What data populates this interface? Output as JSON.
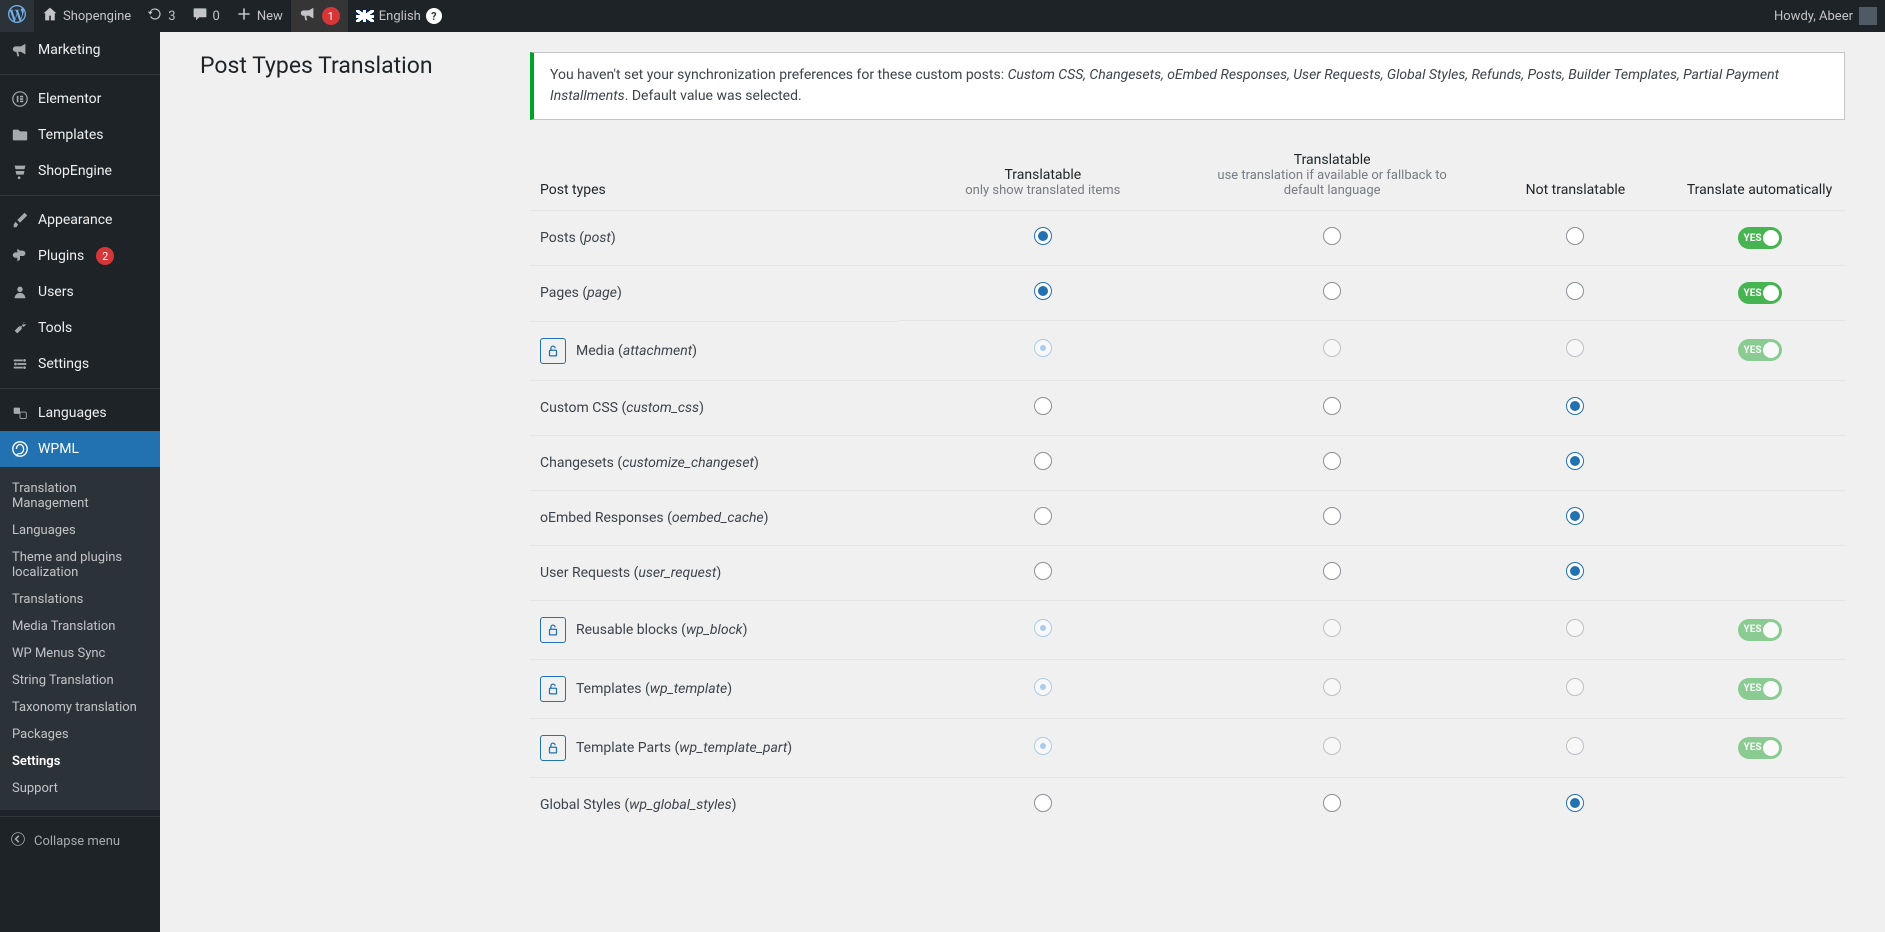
{
  "toolbar": {
    "site_name": "Shopengine",
    "refresh_count": "3",
    "comments_count": "0",
    "new_label": "New",
    "notif_count": "1",
    "language_label": "English",
    "howdy": "Howdy, Abeer"
  },
  "menu": {
    "marketing": "Marketing",
    "elementor": "Elementor",
    "templates": "Templates",
    "shopengine": "ShopEngine",
    "appearance": "Appearance",
    "plugins": "Plugins",
    "plugins_badge": "2",
    "users": "Users",
    "tools": "Tools",
    "settings": "Settings",
    "languages": "Languages",
    "wpml": "WPML",
    "collapse": "Collapse menu"
  },
  "submenu": {
    "translation_management": "Translation Management",
    "languages": "Languages",
    "theme_plugins": "Theme and plugins localization",
    "translations": "Translations",
    "media_translation": "Media Translation",
    "wp_menus_sync": "WP Menus Sync",
    "string_translation": "String Translation",
    "taxonomy_translation": "Taxonomy translation",
    "packages": "Packages",
    "settings": "Settings",
    "support": "Support"
  },
  "page": {
    "title": "Post Types Translation",
    "notice_pre": "You haven't set your synchronization preferences for these custom posts: ",
    "notice_items": "Custom CSS, Changesets, oEmbed Responses, User Requests, Global Styles, Refunds, Posts, Builder Templates, Partial Payment Installments",
    "notice_post": ". Default value was selected."
  },
  "table": {
    "headers": {
      "post_types": "Post types",
      "col1_main": "Translatable",
      "col1_sub": "only show translated items",
      "col2_main": "Translatable",
      "col2_sub": "use translation if available or fallback to default language",
      "col3": "Not translatable",
      "col4": "Translate automatically"
    },
    "toggle_yes": "YES",
    "rows": [
      {
        "label": "Posts",
        "slug": "post",
        "locked": false,
        "selected": 0,
        "toggle": true
      },
      {
        "label": "Pages",
        "slug": "page",
        "locked": false,
        "selected": 0,
        "toggle": true
      },
      {
        "label": "Media",
        "slug": "attachment",
        "locked": true,
        "selected": 0,
        "toggle": true
      },
      {
        "label": "Custom CSS",
        "slug": "custom_css",
        "locked": false,
        "selected": 2,
        "toggle": false
      },
      {
        "label": "Changesets",
        "slug": "customize_changeset",
        "locked": false,
        "selected": 2,
        "toggle": false
      },
      {
        "label": "oEmbed Responses",
        "slug": "oembed_cache",
        "locked": false,
        "selected": 2,
        "toggle": false
      },
      {
        "label": "User Requests",
        "slug": "user_request",
        "locked": false,
        "selected": 2,
        "toggle": false
      },
      {
        "label": "Reusable blocks",
        "slug": "wp_block",
        "locked": true,
        "selected": 0,
        "toggle": true
      },
      {
        "label": "Templates",
        "slug": "wp_template",
        "locked": true,
        "selected": 0,
        "toggle": true
      },
      {
        "label": "Template Parts",
        "slug": "wp_template_part",
        "locked": true,
        "selected": 0,
        "toggle": true
      },
      {
        "label": "Global Styles",
        "slug": "wp_global_styles",
        "locked": false,
        "selected": 2,
        "toggle": false
      }
    ]
  }
}
